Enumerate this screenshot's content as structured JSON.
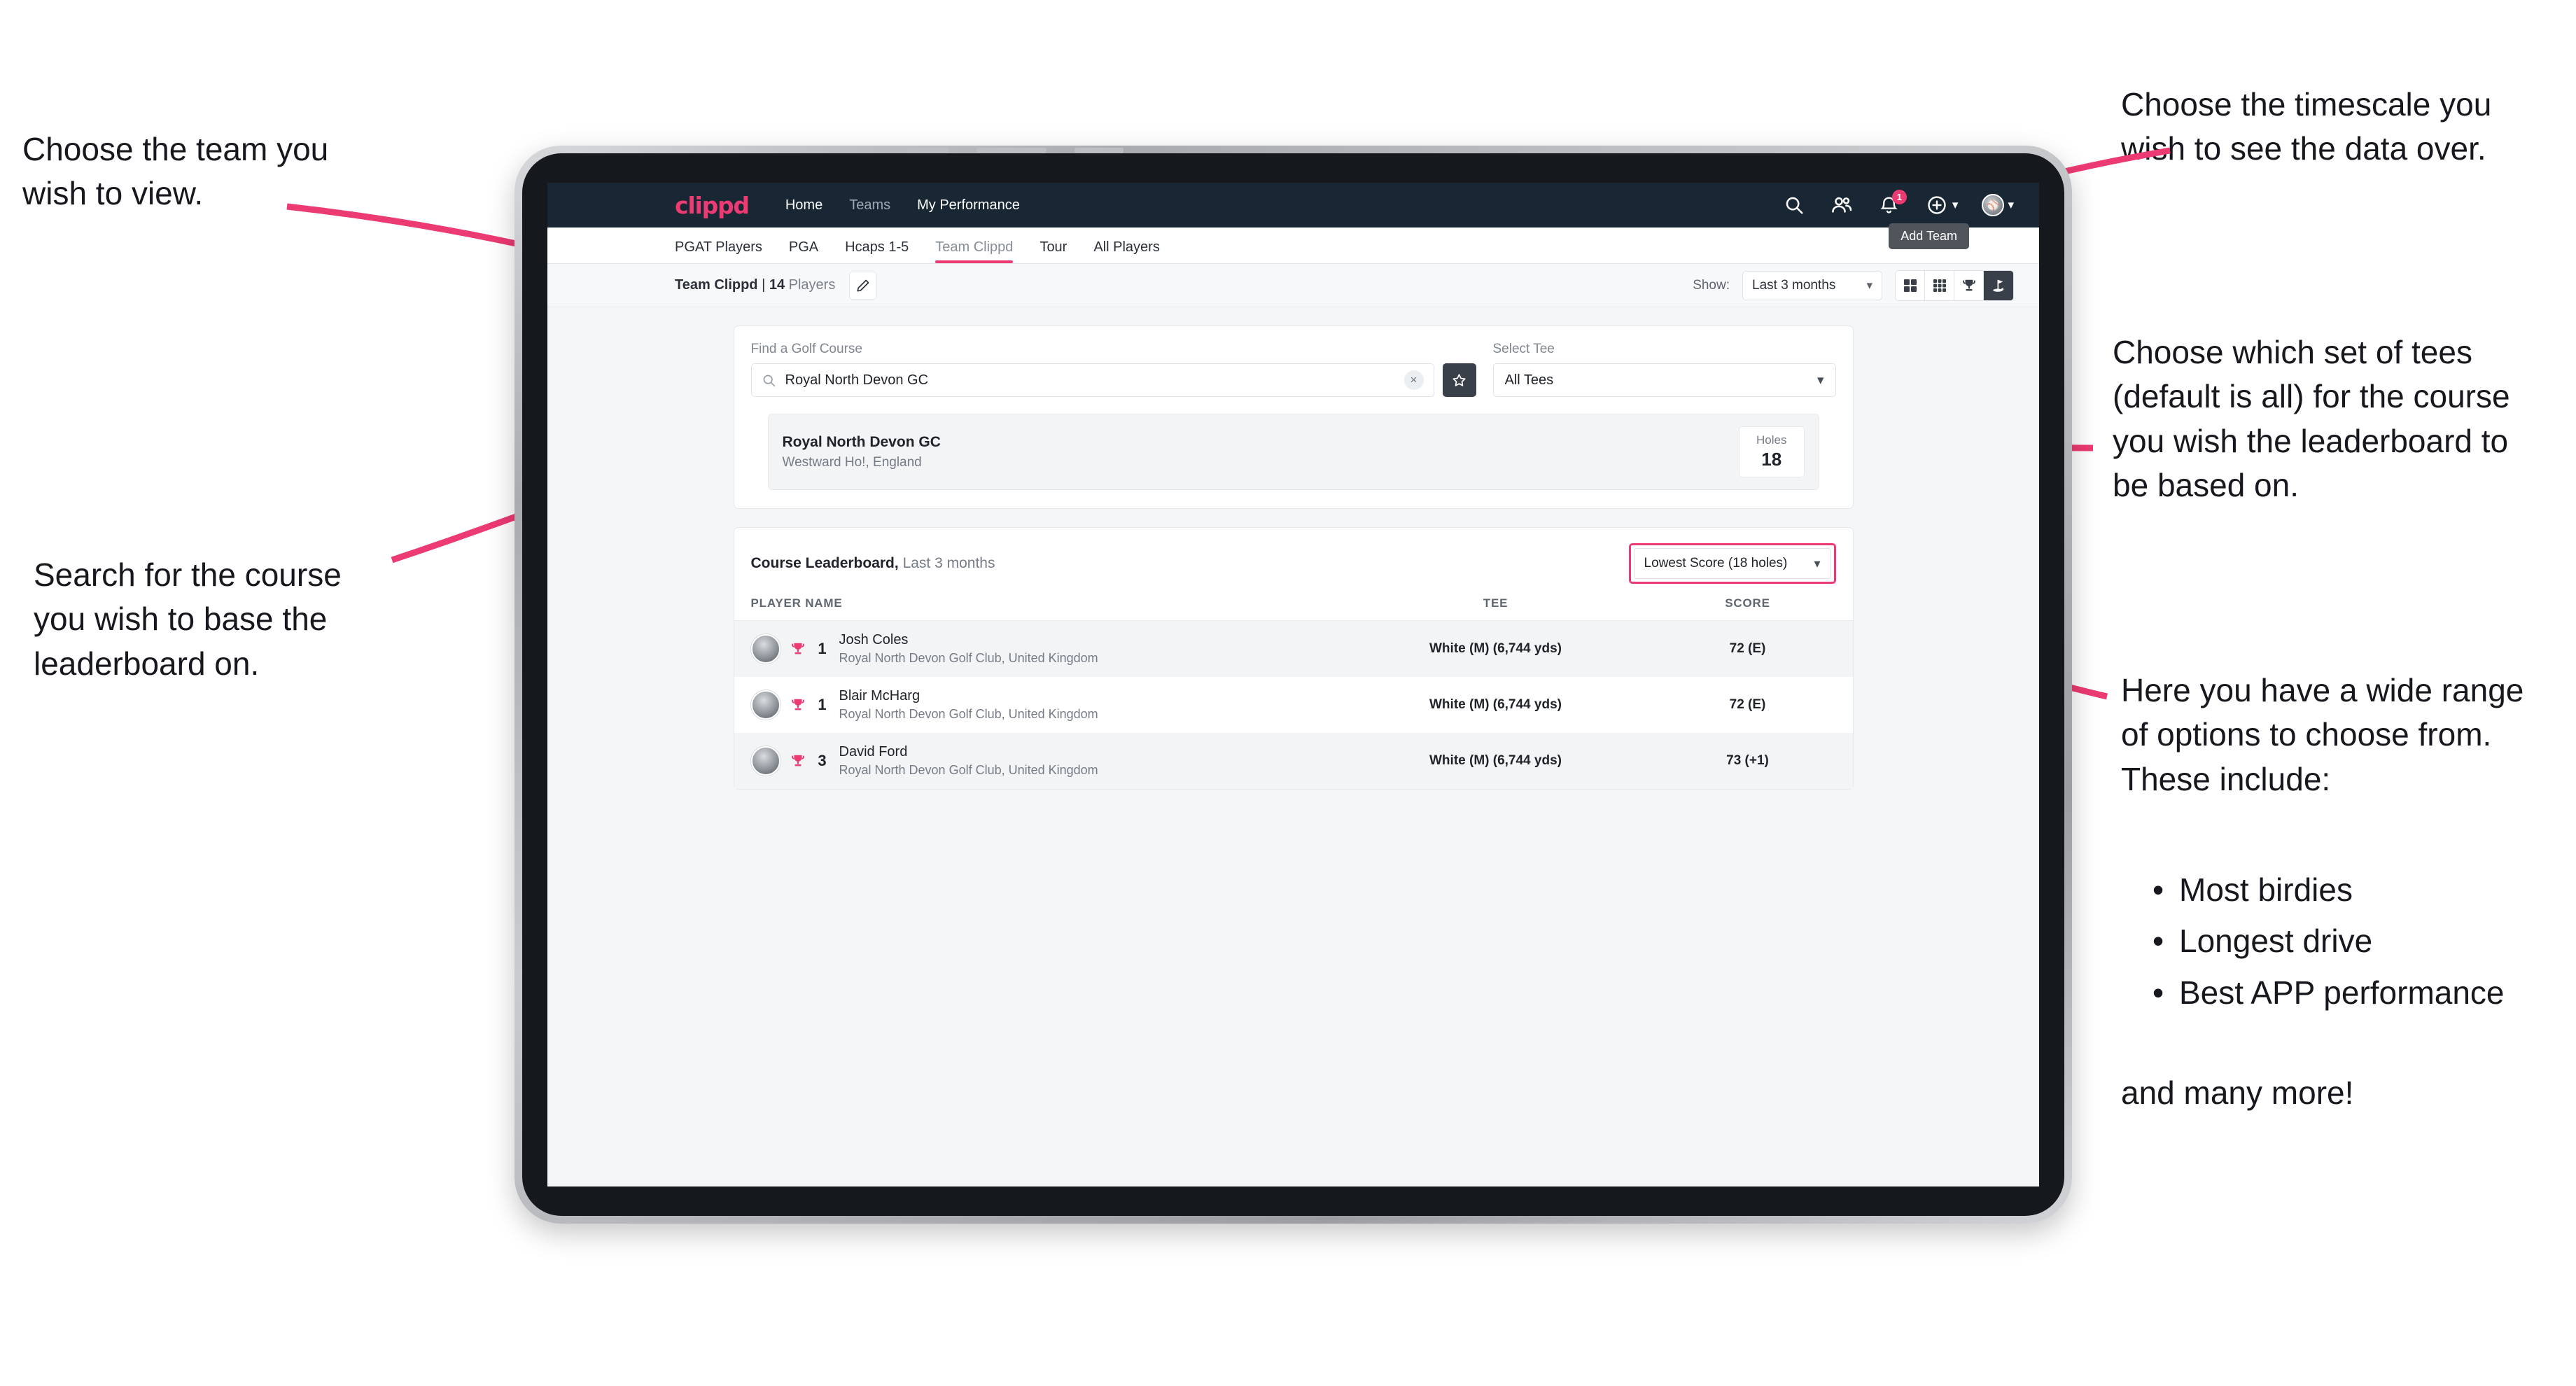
{
  "annotations": {
    "team": "Choose the team you\nwish to view.",
    "timescale": "Choose the timescale you\nwish to see the data over.",
    "tees": "Choose which set of tees\n(default is all) for the course\nyou wish the leaderboard to\nbe based on.",
    "search": "Search for the course\nyou wish to base the\nleaderboard on.",
    "options_intro": "Here you have a wide range\nof options to choose from.\nThese include:",
    "options_items": [
      "Most birdies",
      "Longest drive",
      "Best APP performance"
    ],
    "options_outro": "and many more!"
  },
  "colors": {
    "accent": "#ec3a72",
    "appbar": "#192734",
    "dark_btn": "#3a4049"
  },
  "app": {
    "brand": "clippd",
    "nav": [
      {
        "label": "Home",
        "dim": false
      },
      {
        "label": "Teams",
        "dim": true
      },
      {
        "label": "My Performance",
        "dim": false
      }
    ],
    "header_icons": [
      {
        "name": "search-icon"
      },
      {
        "name": "people-icon"
      },
      {
        "name": "bell-icon",
        "badge": "1"
      },
      {
        "name": "plus-circle-icon"
      },
      {
        "name": "account-avatar"
      }
    ],
    "tabs": [
      {
        "label": "PGAT Players",
        "active": false,
        "dim": false
      },
      {
        "label": "PGA",
        "active": false,
        "dim": false
      },
      {
        "label": "Hcaps 1-5",
        "active": false,
        "dim": false
      },
      {
        "label": "Team Clippd",
        "active": true,
        "dim": true
      },
      {
        "label": "Tour",
        "active": false,
        "dim": false
      },
      {
        "label": "All Players",
        "active": false,
        "dim": false
      }
    ],
    "tooltip": "Add Team",
    "toolbar": {
      "team_name": "Team Clippd",
      "separator": " | ",
      "player_count": "14",
      "players_word": " Players",
      "edit_icon": "pencil-icon",
      "show_label": "Show:",
      "show_value": "Last 3 months",
      "views": [
        {
          "name": "grid-2x2-view",
          "active": false
        },
        {
          "name": "grid-3x3-view",
          "active": false
        },
        {
          "name": "trophy-view",
          "active": false
        },
        {
          "name": "course-pin-view",
          "active": true
        }
      ]
    },
    "search_card": {
      "course_label": "Find a Golf Course",
      "course_value": "Royal North Devon GC",
      "course_placeholder": "Find a Golf Course",
      "clear_label": "×",
      "star_icon": "star-icon",
      "tee_label": "Select Tee",
      "tee_value": "All Tees"
    },
    "course_result": {
      "name": "Royal North Devon GC",
      "location": "Westward Ho!, England",
      "holes_label": "Holes",
      "holes_value": "18"
    },
    "leaderboard": {
      "title": "Course Leaderboard,",
      "subtitle": " Last 3 months",
      "metric_value": "Lowest Score (18 holes)",
      "columns": [
        "PLAYER NAME",
        "TEE",
        "SCORE"
      ],
      "rows": [
        {
          "rank": "1",
          "name": "Josh Coles",
          "club": "Royal North Devon Golf Club, United Kingdom",
          "tee": "White (M) (6,744 yds)",
          "score": "72 (E)"
        },
        {
          "rank": "1",
          "name": "Blair McHarg",
          "club": "Royal North Devon Golf Club, United Kingdom",
          "tee": "White (M) (6,744 yds)",
          "score": "72 (E)"
        },
        {
          "rank": "3",
          "name": "David Ford",
          "club": "Royal North Devon Golf Club, United Kingdom",
          "tee": "White (M) (6,744 yds)",
          "score": "73 (+1)"
        }
      ]
    }
  }
}
